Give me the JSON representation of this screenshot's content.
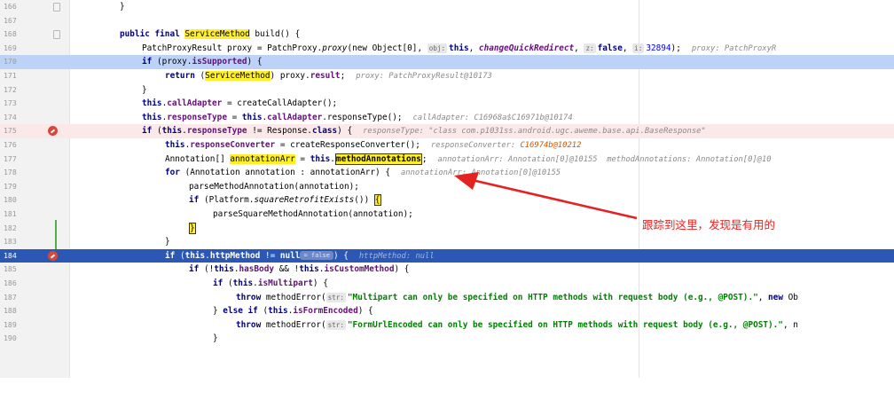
{
  "editor": {
    "line_numbers": [
      "166",
      "167",
      "168",
      "169",
      "170",
      "171",
      "172",
      "173",
      "174",
      "175",
      "176",
      "177",
      "178",
      "179",
      "180",
      "181",
      "182",
      "183",
      "184",
      "185",
      "186",
      "187",
      "188",
      "189",
      "190"
    ],
    "lines": {
      "l166": {
        "brace": "}"
      },
      "l168": {
        "public_final": "public final",
        "type": "ServiceMethod",
        "rest": " build() {"
      },
      "l169": {
        "code": "PatchProxyResult proxy = PatchProxy.",
        "method": "proxy",
        "open": "(new Object[0], ",
        "obj_badge": "obj:",
        "this_kw": "this",
        "comma1": ", ",
        "quick": "changeQuickRedirect",
        "comma2": ", ",
        "z_badge": "z:",
        "false_kw": "false",
        "comma3": ", ",
        "i_badge": "i:",
        "num": "32894",
        "close": ");",
        "cmt": "proxy: PatchProxyR"
      },
      "l170": {
        "if_kw": "if",
        "open": " (proxy.",
        "fld": "isSupported",
        "close": ") {"
      },
      "l171": {
        "return_kw": "return",
        "open": " (",
        "type": "ServiceMethod",
        "rest": ") proxy.",
        "fld": "result",
        "end": ";",
        "cmt": "proxy: PatchProxyResult@10173"
      },
      "l172": {
        "brace": "}"
      },
      "l173": {
        "this_kw": "this",
        "dot": ".",
        "fld": "callAdapter",
        "rest": " = createCallAdapter();"
      },
      "l174": {
        "this_kw": "this",
        "dot": ".",
        "fld": "responseType",
        "rest": " = ",
        "this2": "this",
        "dot2": ".",
        "fld2": "callAdapter",
        "end": ".responseType();",
        "cmt": "callAdapter: C16968a$C16971b@10174"
      },
      "l175": {
        "if_kw": "if",
        "open": " (",
        "this_kw": "this",
        "dot": ".",
        "fld": "responseType",
        "rest": " != Response.",
        "class_kw": "class",
        "close": ") {",
        "cmt": "responseType: \"class com.p1031ss.android.ugc.aweme.base.api.BaseResponse\""
      },
      "l176": {
        "this_kw": "this",
        "dot": ".",
        "fld": "responseConverter",
        "rest": " = createResponseConverter();",
        "cmt": "responseConverter:",
        "cmt_val": "C16974b@10212"
      },
      "l177": {
        "code": "Annotation[] ",
        "hl_var": "annotationArr",
        "eq": " = ",
        "this_kw": "this",
        "dot": ".",
        "hl_fld": "methodAnnotations",
        "end": ";",
        "cmt": "annotationArr: Annotation[0]@10155  methodAnnotations: Annotation[0]@10"
      },
      "l178": {
        "for_kw": "for",
        "rest": " (Annotation annotation : annotationArr) {",
        "cmt": "annotationArr: Annotation[0]@10155"
      },
      "l179": {
        "code": "parseMethodAnnotation(annotation);"
      },
      "l180": {
        "if_kw": "if",
        "open": " (Platform.",
        "method": "squareRetrofitExists",
        "close": "()) ",
        "brace": "{"
      },
      "l181": {
        "code": "parseSquareMethodAnnotation(annotation);"
      },
      "l182": {
        "brace": "}"
      },
      "l183": {
        "brace": "}"
      },
      "l184": {
        "if_kw": "if",
        "open": " (",
        "this_kw": "this",
        "dot": ".",
        "fld": "httpMethod",
        "rest": " != ",
        "null_kw": "null",
        "pill": "= false",
        "close": ") {",
        "cmt": "httpMethod: null"
      },
      "l185": {
        "if_kw": "if",
        "open": " (!",
        "this_kw": "this",
        "dot": ".",
        "fld": "hasBody",
        "and": " && !",
        "this2": "this",
        "dot2": ".",
        "fld2": "isCustomMethod",
        "close": ") {"
      },
      "l186": {
        "if_kw": "if",
        "open": " (",
        "this_kw": "this",
        "dot": ".",
        "fld": "isMultipart",
        "close": ") {"
      },
      "l187": {
        "throw_kw": "throw",
        "rest": " methodError(",
        "str_badge": "str:",
        "str": "\"Multipart can only be specified on HTTP methods with request body (e.g., @POST).\"",
        "comma": ", ",
        "new_kw": "new",
        "end": " Ob"
      },
      "l188": {
        "close_brace": "} ",
        "else_kw": "else if",
        "open": " (",
        "this_kw": "this",
        "dot": ".",
        "fld": "isFormEncoded",
        "close": ") {"
      },
      "l189": {
        "throw_kw": "throw",
        "rest": " methodError(",
        "str_badge": "str:",
        "str": "\"FormUrlEncoded can only be specified on HTTP methods with request body (e.g., @POST).\"",
        "comma": ", ",
        "end": "n"
      },
      "l190": {
        "brace": "}"
      }
    }
  },
  "annotation": {
    "text": "跟踪到这里，发现是有用的",
    "color": "#e52222"
  },
  "colors": {
    "keyword": "#000080",
    "field": "#660e7a",
    "string": "#008000",
    "exec_line": "#bcd3f7",
    "breakpoint_line": "#fbe9e9",
    "current_line": "#2b58b5",
    "highlight": "#ffef28"
  },
  "icons": {
    "breakpoint": "breakpoint-icon",
    "fold": "fold-marker-icon",
    "arrow": "annotation-arrow-icon"
  }
}
